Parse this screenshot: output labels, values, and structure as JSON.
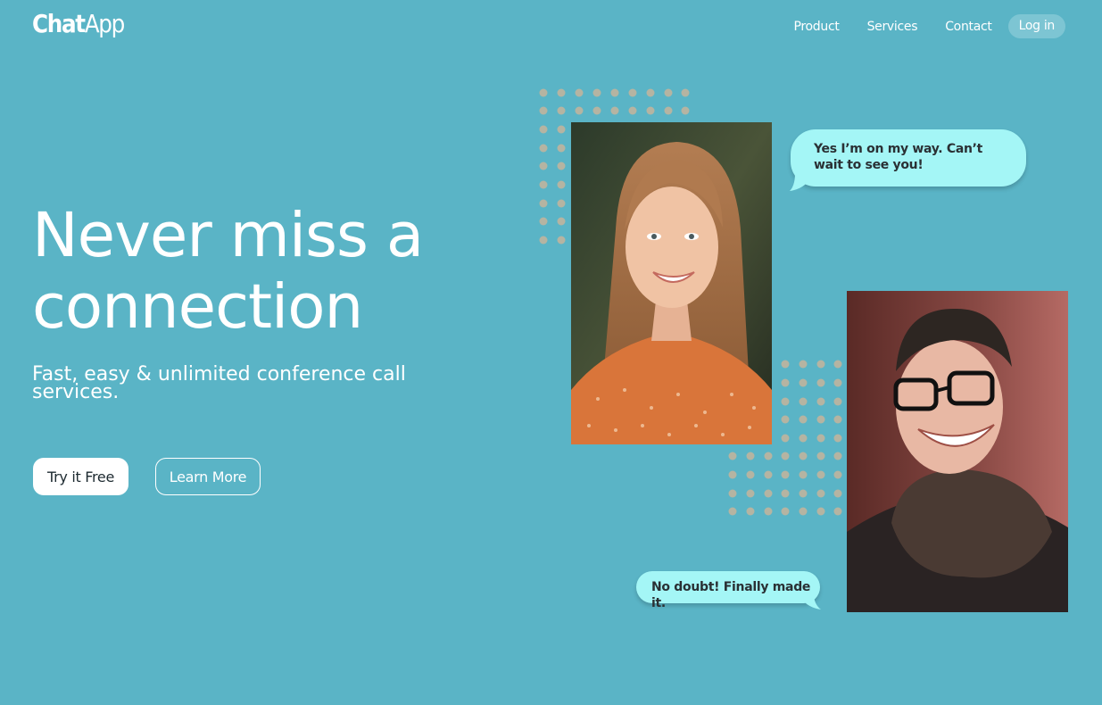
{
  "header": {
    "logo_bold": "Chat",
    "logo_light": "App",
    "nav": [
      {
        "label": "Product"
      },
      {
        "label": "Services"
      },
      {
        "label": "Contact"
      }
    ],
    "login_label": "Log in"
  },
  "hero": {
    "headline_line1": "Never miss a",
    "headline_line2": "connection",
    "subheadline": "Fast, easy & unlimited conference call services.",
    "primary_cta": "Try it Free",
    "secondary_cta": "Learn More"
  },
  "chat": {
    "bubble_1": "Yes I’m on my way. Can’t wait to see you!",
    "bubble_2": "No doubt! Finally made it."
  },
  "colors": {
    "background": "#5ab4c6",
    "bubble": "#a4f6f6",
    "dot": "#b5b4a2",
    "login_pill": "#7dc5d3"
  }
}
